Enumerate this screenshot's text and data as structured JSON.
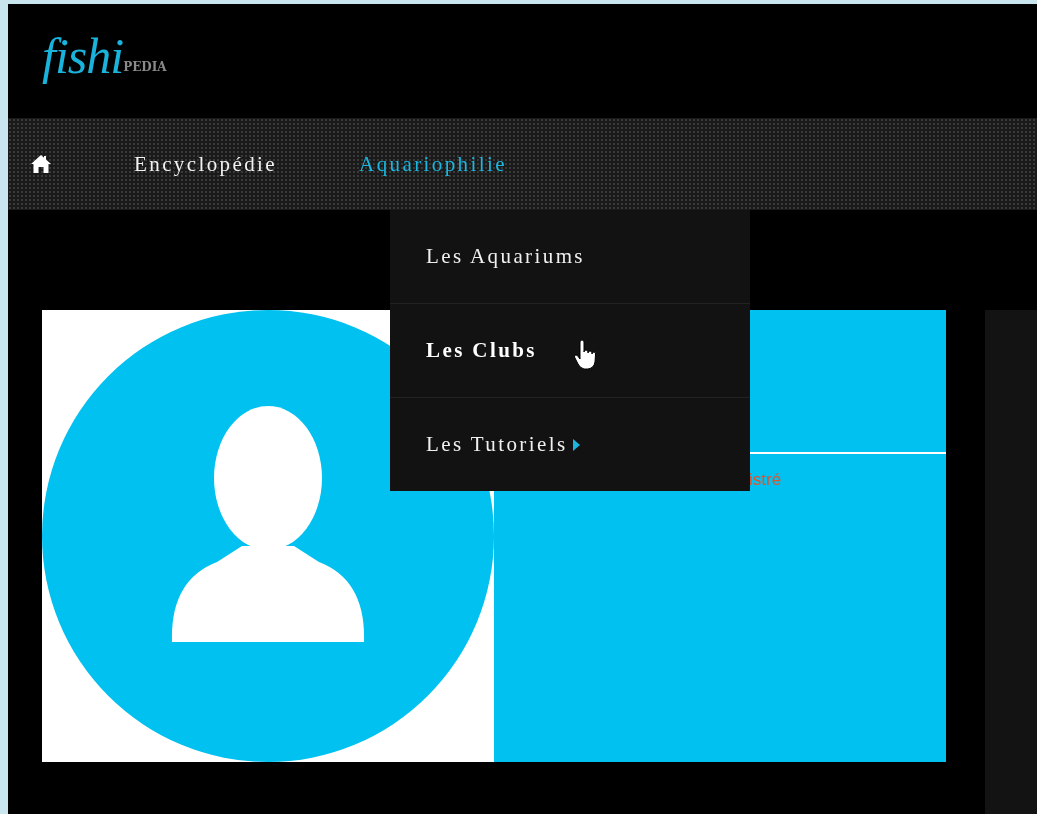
{
  "logo": {
    "script": "fishi",
    "caps": "PEDIA"
  },
  "nav": [
    {
      "kind": "home",
      "selected": false
    },
    {
      "kind": "link",
      "label": "Encyclopédie",
      "selected": false
    },
    {
      "kind": "link",
      "label": "Aquariophilie",
      "selected": true
    }
  ],
  "dropdown": [
    {
      "label": "Les Aquariums",
      "hovered": false,
      "submenu": false
    },
    {
      "label": "Les Clubs",
      "hovered": true,
      "submenu": false
    },
    {
      "label": "Les Tutoriels",
      "hovered": false,
      "submenu": true
    }
  ],
  "profile": {
    "avatar": {
      "kind": "default"
    },
    "status_fragment": "istré"
  }
}
